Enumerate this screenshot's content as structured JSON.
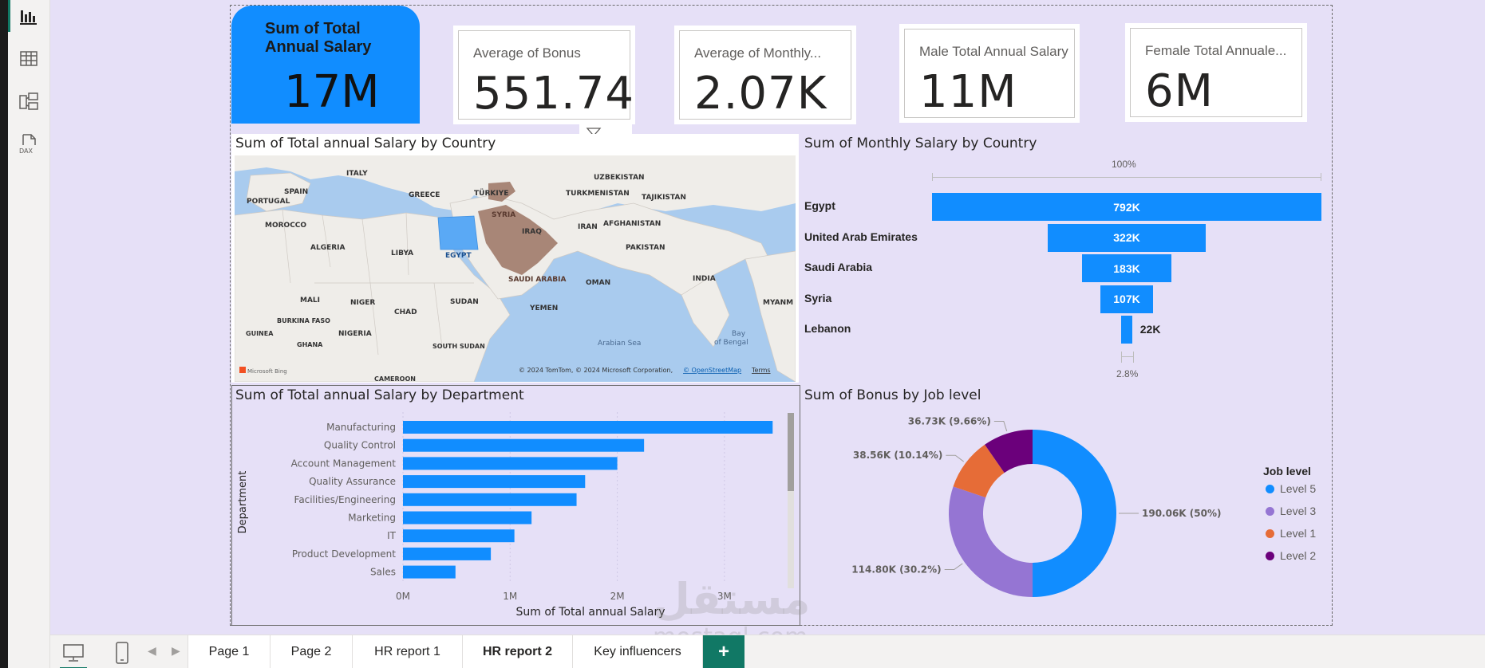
{
  "nav": {
    "items": [
      {
        "icon": "report-view-icon"
      },
      {
        "icon": "table-view-icon"
      },
      {
        "icon": "model-view-icon"
      },
      {
        "icon": "dax-query-view-icon",
        "text": "DAX"
      }
    ]
  },
  "cards": {
    "total_salary": {
      "title_line1": "Sum of Total",
      "title_line2": "Annual Salary",
      "value": "17M"
    },
    "avg_bonus": {
      "label": "Average of Bonus",
      "value": "551.74"
    },
    "avg_monthly": {
      "label": "Average of Monthly...",
      "value": "2.07K"
    },
    "male_total": {
      "label": "Male Total Annual Salary",
      "value": "11M"
    },
    "female_total": {
      "label": "Female Total Annuale...",
      "value": "6M"
    }
  },
  "map": {
    "title": "Sum of Total annual Salary by Country",
    "labels": [
      "ITALY",
      "SPAIN",
      "PORTUGAL",
      "GREECE",
      "TÜRKIYE",
      "UZBEKISTAN",
      "TURKMENISTAN",
      "TAJIKISTAN",
      "MOROCCO",
      "ALGERIA",
      "LIBYA",
      "EGYPT",
      "SYRIA",
      "IRAQ",
      "IRAN",
      "AFGHANISTAN",
      "PAKISTAN",
      "INDIA",
      "SAUDI ARABIA",
      "OMAN",
      "YEMEN",
      "SUDAN",
      "MALI",
      "NIGER",
      "CHAD",
      "BURKINA FASO",
      "NIGERIA",
      "GUINEA",
      "GHANA",
      "SOUTH SUDAN",
      "CAMEROON",
      "MYANM",
      "Arabian Sea",
      "Bay",
      "of Bengal"
    ],
    "attribution": "© 2024 TomTom, © 2024 Microsoft Corporation,",
    "attribution_link": "© OpenStreetMap",
    "terms": "Terms",
    "bing": "Microsoft Bing",
    "colors": {
      "egypt": "#5aa9f5",
      "saudi": "#a07a6a",
      "syria": "#a07a6a",
      "land": "#f2f0ee",
      "water": "#a9cbee"
    }
  },
  "funnel": {
    "title": "Sum of Monthly Salary by Country",
    "top_label": "100%",
    "bottom_label": "2.8%",
    "chart_data": {
      "type": "funnel",
      "categories": [
        "Egypt",
        "United Arab Emirates",
        "Saudi Arabia",
        "Syria",
        "Lebanon"
      ],
      "values": [
        792,
        322,
        183,
        107,
        22
      ],
      "value_labels": [
        "792K",
        "322K",
        "183K",
        "107K",
        "22K"
      ],
      "unit": "K"
    }
  },
  "dept": {
    "title": "Sum of Total annual Salary by Department",
    "xlabel": "Sum of Total annual Salary",
    "ylabel": "Department",
    "chart_data": {
      "type": "bar",
      "orientation": "horizontal",
      "categories": [
        "Manufacturing",
        "Quality Control",
        "Account Management",
        "Quality Assurance",
        "Facilities/Engineering",
        "Marketing",
        "IT",
        "Product Development",
        "Sales"
      ],
      "values": [
        3.45,
        2.25,
        2.0,
        1.7,
        1.62,
        1.2,
        1.04,
        0.82,
        0.49
      ],
      "xticks": [
        "0M",
        "1M",
        "2M",
        "3M"
      ],
      "xlim": [
        0,
        3.5
      ],
      "unit": "M"
    }
  },
  "bonus": {
    "title": "Sum of Bonus by Job level",
    "legend_title": "Job level",
    "chart_data": {
      "type": "pie",
      "donut": true,
      "categories": [
        "Level 5",
        "Level 3",
        "Level 1",
        "Level 2"
      ],
      "values": [
        190.06,
        114.8,
        38.56,
        36.73
      ],
      "percents": [
        50,
        30.2,
        10.14,
        9.66
      ],
      "labels": [
        "190.06K (50%)",
        "114.80K (30.2%)",
        "38.56K (10.14%)",
        "36.73K (9.66%)"
      ],
      "colors": [
        "#118dff",
        "#9575d3",
        "#e66c37",
        "#6b007b"
      ]
    }
  },
  "tabs": {
    "items": [
      {
        "label": "Page 1"
      },
      {
        "label": "Page 2"
      },
      {
        "label": "HR report 1"
      },
      {
        "label": "HR report 2",
        "active": true
      },
      {
        "label": "Key influencers"
      }
    ],
    "add_label": "+"
  },
  "watermark": {
    "ar": "مستقل",
    "en": "mostaql.com"
  }
}
